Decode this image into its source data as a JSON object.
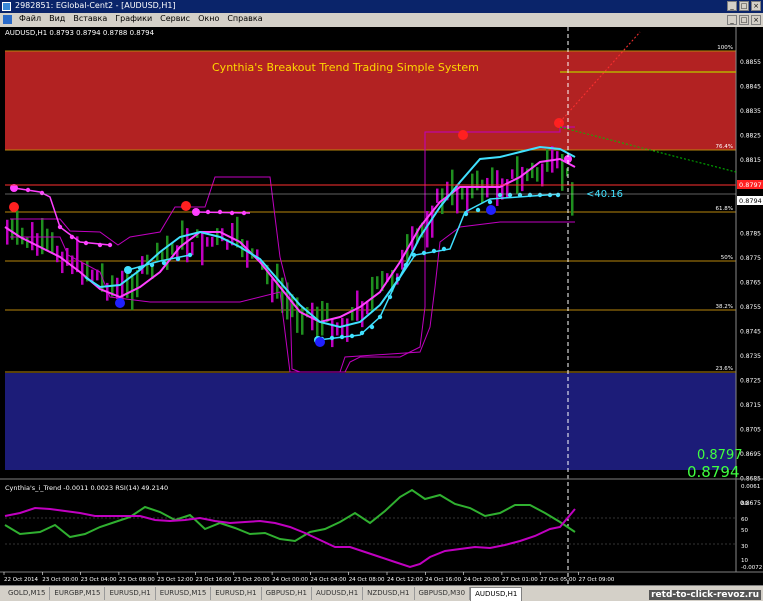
{
  "window": {
    "title": "2982851: EGlobal-Cent2 - [AUDUSD,H1]"
  },
  "menu": [
    "Файл",
    "Вид",
    "Вставка",
    "Графики",
    "Сервис",
    "Окно",
    "Справка"
  ],
  "main_chart": {
    "header": "AUDUSD,H1  0.8793 0.8794 0.8788 0.8794",
    "title": "Cynthia's Breakout Trend Trading Simple System",
    "price_labels": [
      "0.8855",
      "0.8845",
      "0.8835",
      "0.8825",
      "0.8815",
      "0.8805",
      "0.8794",
      "0.8785",
      "0.8775",
      "0.8765",
      "0.8755",
      "0.8745",
      "0.8735",
      "0.8725",
      "0.8715",
      "0.8705",
      "0.8695",
      "0.8685",
      "0.8675"
    ],
    "current_price_tag": "0.8794",
    "red_price_tag": "0.8797",
    "fib_levels": [
      "100%",
      "76.4%",
      "61.8%",
      "50%",
      "38.2%",
      "23.6%"
    ],
    "pips_label": "<40.16",
    "bid_price": "0.8797",
    "ask_price": "0.8794",
    "time_labels": [
      "22 Oct 2014",
      "23 Oct 00:00",
      "23 Oct 04:00",
      "23 Oct 08:00",
      "23 Oct 12:00",
      "23 Oct 16:00",
      "23 Oct 20:00",
      "24 Oct 00:00",
      "24 Oct 04:00",
      "24 Oct 08:00",
      "24 Oct 12:00",
      "24 Oct 16:00",
      "24 Oct 20:00",
      "27 Oct 01:00",
      "27 Oct 05:00",
      "27 Oct 09:00"
    ],
    "colors": {
      "upper_zone": "#b22222",
      "lower_zone": "#1c1c78",
      "fib_line": "#b8860b",
      "title": "#ffd700",
      "cyan_line": "#40e0ff",
      "magenta_line": "#ff40ff",
      "green_bars": "#1f8f1f",
      "magenta_bars": "#c000c0"
    }
  },
  "indicator": {
    "header": "Cynthia's_i_Trend -0.0011 0.0023  RSI(14) 49.2140",
    "scale_labels": [
      "0.0061",
      "80",
      "60",
      "50",
      "30",
      "10",
      "-0.0072"
    ]
  },
  "tabs": [
    "GOLD,M15",
    "EURGBP,M15",
    "EURUSD,H1",
    "EURUSD,M15",
    "EURUSD,H1",
    "GBPUSD,H1",
    "AUDUSD,H1",
    "NZDUSD,H1",
    "GBPUSD,M30",
    "AUDUSD,H1"
  ],
  "active_tab_index": 9,
  "watermark": "retd-to-click-revoz.ru"
}
